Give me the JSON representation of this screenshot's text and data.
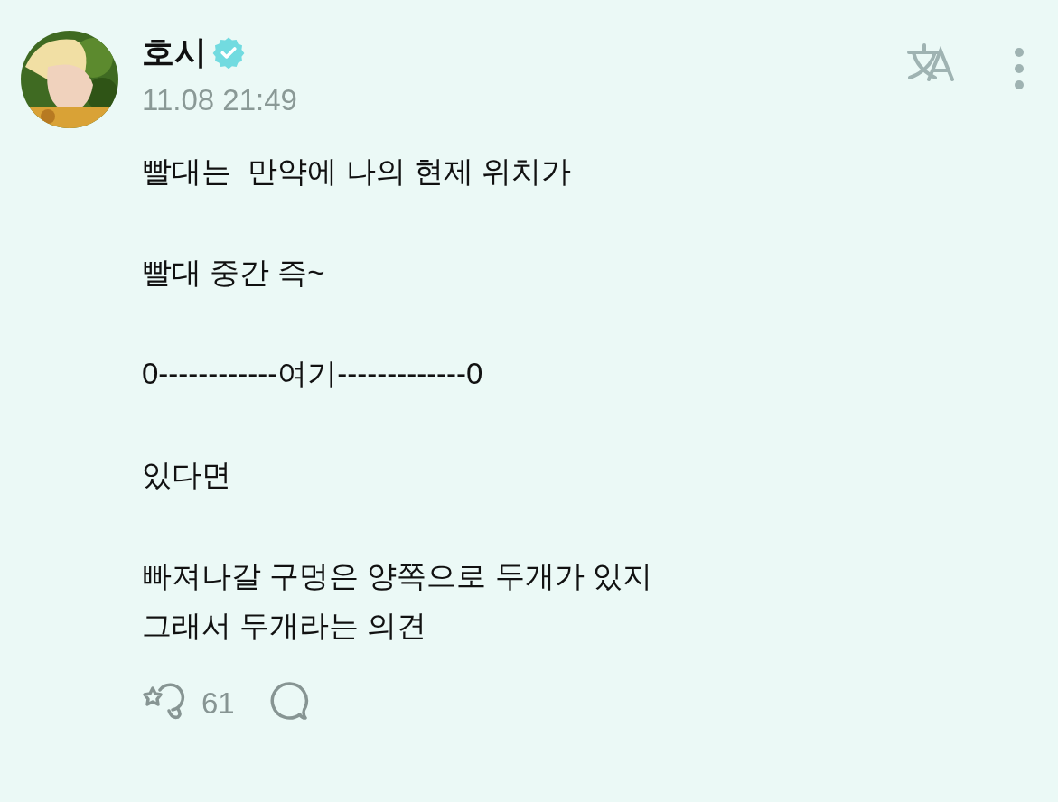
{
  "post": {
    "author": "호시",
    "verified": true,
    "time": "11.08 21:49",
    "paragraphs": [
      {
        "lines": [
          "빨대는  만약에 나의 현제 위치가"
        ]
      },
      {
        "lines": [
          "빨대 중간 즉~"
        ]
      },
      {
        "lines": [
          "0------------여기-------------0"
        ]
      },
      {
        "lines": [
          "있다면"
        ]
      },
      {
        "lines": [
          "빠져나갈 구멍은 양쪽으로 두개가 있지",
          "그래서 두개라는 의견"
        ]
      }
    ],
    "reactions": {
      "count": "61"
    }
  }
}
